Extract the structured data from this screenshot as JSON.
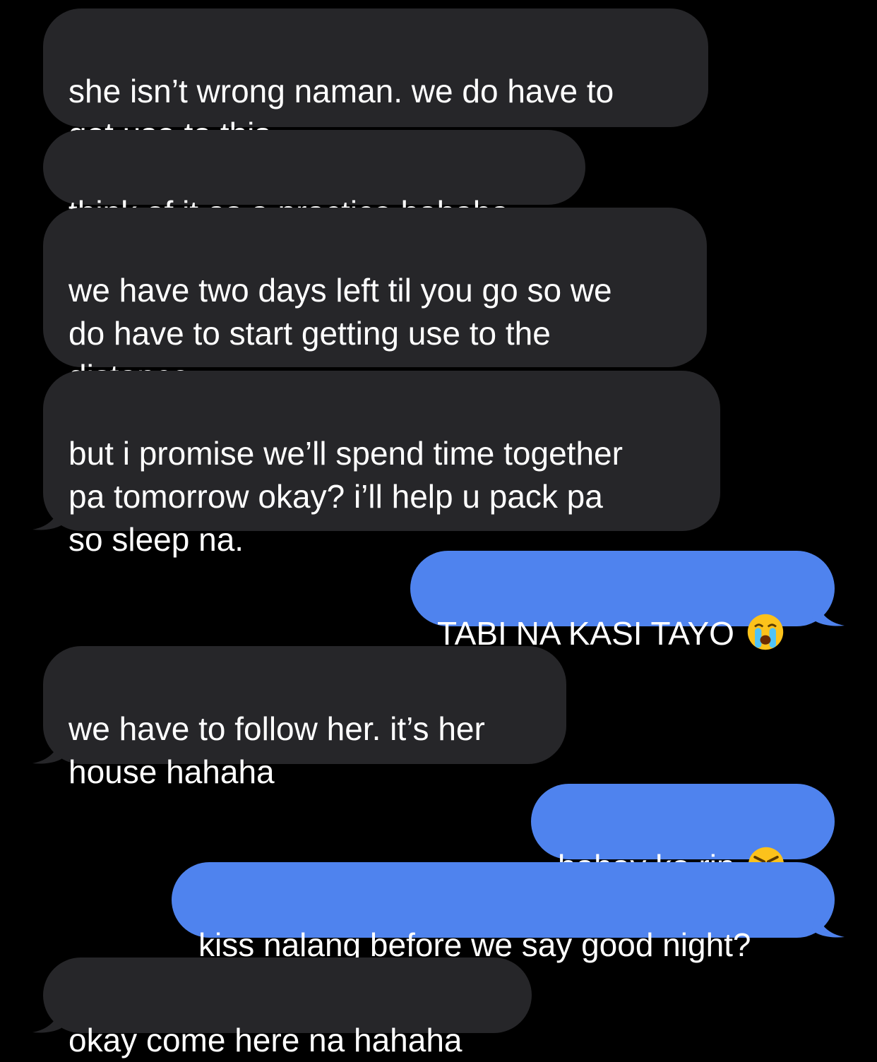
{
  "theme": {
    "background": "#000000",
    "received_bubble": "#262629",
    "sent_bubble": "#4f83ee",
    "text": "#ffffff"
  },
  "messages": [
    {
      "direction": "received",
      "text": "she isn’t wrong naman. we do have to\nget use to this"
    },
    {
      "direction": "received",
      "text": "think of it as a practice hahaha"
    },
    {
      "direction": "received",
      "text": "we have two days left til you go so we\ndo have to start getting use to the\ndistance"
    },
    {
      "direction": "received",
      "text": "but i promise we’ll spend time together\npa tomorrow okay? i’ll help u pack pa\nso sleep na."
    },
    {
      "direction": "sent",
      "text": "TABI NA KASI TAYO",
      "emoji": "loudly-crying-face-icon"
    },
    {
      "direction": "received",
      "text": "we have to follow her. it’s her\nhouse hahaha"
    },
    {
      "direction": "sent",
      "text": "bahay ko rin",
      "emoji": "angry-face-icon"
    },
    {
      "direction": "sent",
      "text": "kiss nalang before we say good night?"
    },
    {
      "direction": "received",
      "text": "okay come here na hahaha"
    }
  ]
}
